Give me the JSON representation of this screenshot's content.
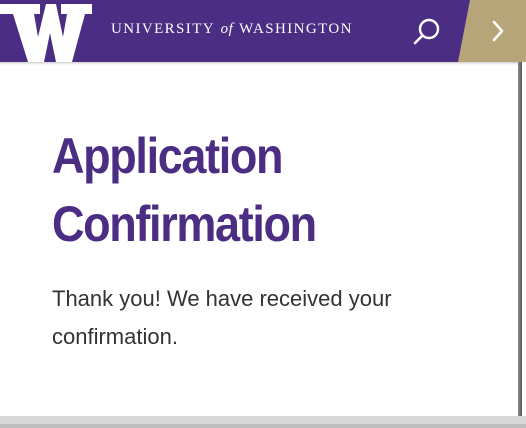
{
  "header": {
    "logo": {
      "letter": "W",
      "icon": "uw-w-logo"
    },
    "wordmark": {
      "before": "UNIVERSITY",
      "of": "of",
      "after": "WASHINGTON"
    },
    "search_icon": "search-icon",
    "next_icon": "chevron-right-icon"
  },
  "main": {
    "title_lines": [
      "Application",
      "Confirmation"
    ],
    "message_line1": "Thank you! We have received your",
    "message_line2": "confirmation."
  },
  "colors": {
    "brand_purple": "#4b2e83",
    "brand_gold": "#b7a57a",
    "text": "#333333"
  }
}
